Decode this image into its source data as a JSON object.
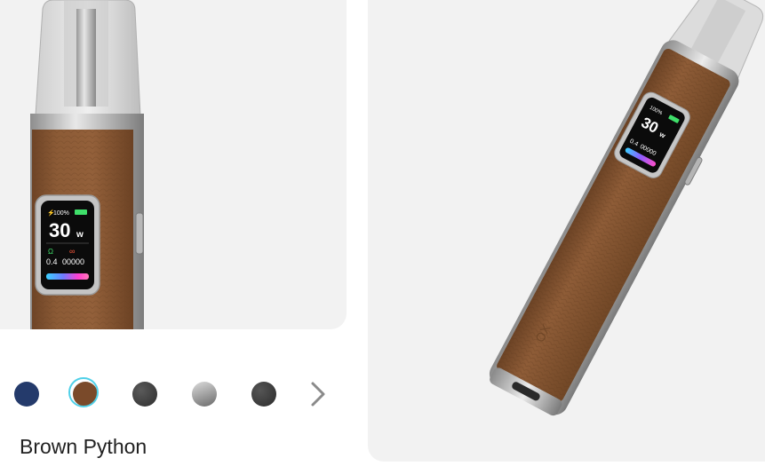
{
  "product": {
    "selected_color_name": "Brown Python"
  },
  "swatches": [
    {
      "name": "navy",
      "color": "#243a6b"
    },
    {
      "name": "brown-python",
      "color": "#7a4a2a",
      "selected": true
    },
    {
      "name": "dark-gray",
      "color": "#3c3c3c"
    },
    {
      "name": "silver-gradient",
      "color": "#9a9a9a"
    },
    {
      "name": "charcoal",
      "color": "#3a3a3a"
    }
  ],
  "device_screen": {
    "battery": "100%",
    "wattage": "30",
    "wattage_unit": "w",
    "resistance": "0.4",
    "puff_count": "00000"
  },
  "colors": {
    "selected_ring": "#4fd0e8",
    "panel_bg": "#f2f2f2",
    "leather": "#8a5a36"
  }
}
